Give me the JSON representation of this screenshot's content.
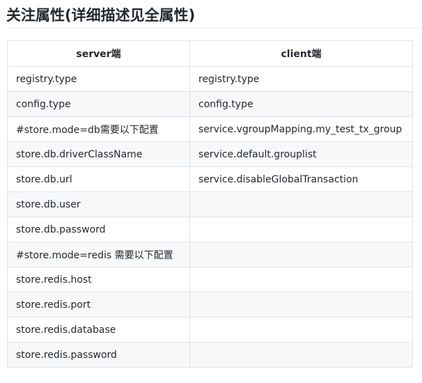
{
  "heading": "关注属性(详细描述见全属性)",
  "table": {
    "headers": [
      "server端",
      "client端"
    ],
    "rows": [
      [
        "registry.type",
        "registry.type"
      ],
      [
        "config.type",
        "config.type"
      ],
      [
        "#store.mode=db需要以下配置",
        "service.vgroupMapping.my_test_tx_group"
      ],
      [
        "store.db.driverClassName",
        "service.default.grouplist"
      ],
      [
        "store.db.url",
        "service.disableGlobalTransaction"
      ],
      [
        "store.db.user",
        ""
      ],
      [
        "store.db.password",
        ""
      ],
      [
        "#store.mode=redis 需要以下配置",
        ""
      ],
      [
        "store.redis.host",
        ""
      ],
      [
        "store.redis.port",
        ""
      ],
      [
        "store.redis.database",
        ""
      ],
      [
        "store.redis.password",
        ""
      ]
    ]
  }
}
